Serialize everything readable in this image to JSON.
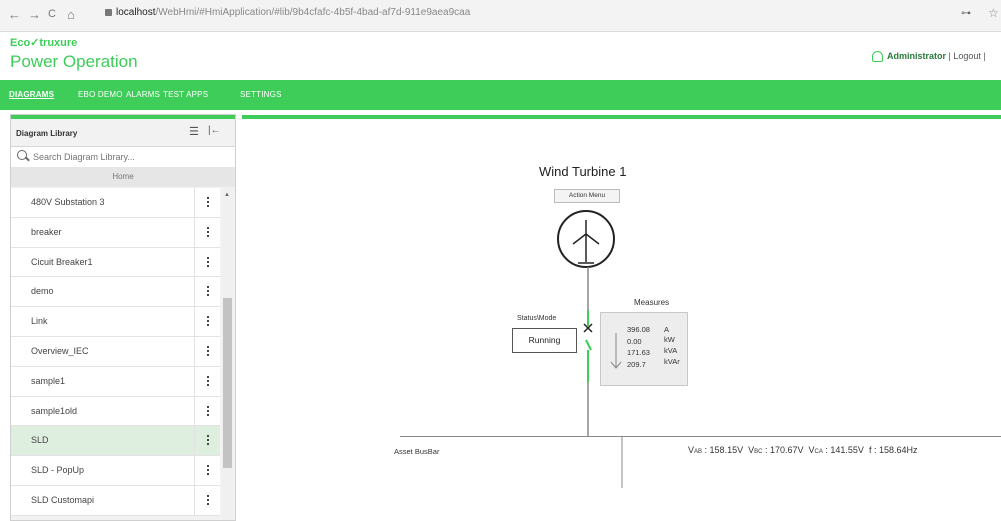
{
  "browser": {
    "back": "←",
    "forward": "→",
    "reload": "C",
    "home": "⌂",
    "url_host": "localhost",
    "url_path": "/WebHmi/#HmiApplication/#lib/9b4cfafc-4b5f-4bad-af7d-911e9aea9caa",
    "key_icon": "key-icon",
    "star_icon": "star-icon"
  },
  "header": {
    "logo": "Eco✓truxure",
    "app_name": "Power Operation",
    "user": "Administrator",
    "separator1": "|",
    "logout": "Logout",
    "separator2": "|"
  },
  "nav": {
    "items": [
      "DIAGRAMS",
      "EBO DEMO",
      "ALARMS",
      "TEST APPS",
      "SETTINGS"
    ],
    "active": "DIAGRAMS"
  },
  "sidebar": {
    "title": "Diagram Library",
    "search_placeholder": "Search Diagram Library...",
    "home": "Home",
    "items": [
      {
        "label": "480V Substation 3"
      },
      {
        "label": "breaker"
      },
      {
        "label": "Cicuit Breaker1"
      },
      {
        "label": "demo"
      },
      {
        "label": "Link"
      },
      {
        "label": "Overview_IEC"
      },
      {
        "label": "sample1"
      },
      {
        "label": "sample1old"
      },
      {
        "label": "SLD",
        "selected": true
      },
      {
        "label": "SLD - PopUp"
      },
      {
        "label": "SLD Customapi"
      }
    ]
  },
  "diagram": {
    "title": "Wind Turbine 1",
    "action_menu": "Action Menu",
    "status_label": "Status\\Mode",
    "status_value": "Running",
    "measures_label": "Measures",
    "measures": [
      {
        "value": "396.08",
        "unit": "A"
      },
      {
        "value": "0.00",
        "unit": "kW"
      },
      {
        "value": "171.63",
        "unit": "kVA"
      },
      {
        "value": "209.7",
        "unit": "kVAr"
      }
    ],
    "busbar_label": "Asset BusBar",
    "readings": {
      "vab_label": "V",
      "vab_sub": "AB",
      "vab_value": ": 158.15V",
      "vbc_label": "V",
      "vbc_sub": "BC",
      "vbc_value": ": 170.67V",
      "vca_label": "V",
      "vca_sub": "CA",
      "vca_value": ": 141.55V",
      "f_label": "f",
      "f_value": ": 158.64Hz"
    },
    "colors": {
      "energized": "#3dcd58",
      "line": "#888888"
    }
  }
}
